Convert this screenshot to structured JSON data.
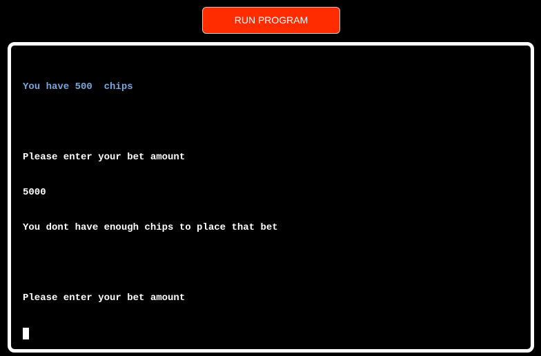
{
  "toolbar": {
    "run_label": "RUN PROGRAM"
  },
  "terminal": {
    "lines": [
      "You have 500  chips",
      "",
      "Please enter your bet amount",
      "5000",
      "You dont have enough chips to place that bet",
      "",
      "Please enter your bet amount"
    ]
  },
  "colors": {
    "button_bg": "#ff2c00",
    "highlight_text": "#7aa6da",
    "terminal_bg": "#000000",
    "terminal_text": "#ffffff"
  }
}
